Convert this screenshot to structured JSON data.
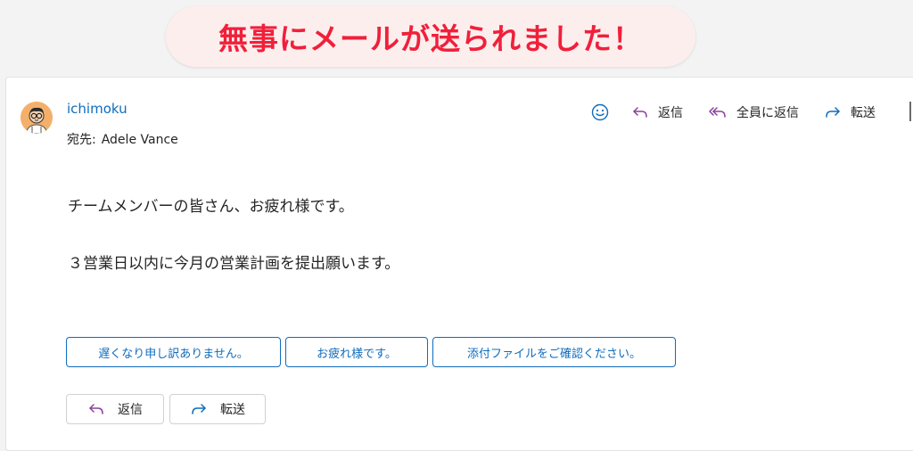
{
  "banner": {
    "text": "無事にメールが送られました！"
  },
  "message": {
    "sender": "ichimoku",
    "to_label": "宛先:",
    "to_name": "Adele Vance",
    "body_lines": [
      "チームメンバーの皆さん、お疲れ様です。",
      "３営業日以内に今月の営業計画を提出願います。"
    ]
  },
  "toolbar": {
    "reply_label": "返信",
    "reply_all_label": "全員に返信",
    "forward_label": "転送"
  },
  "suggested_replies": [
    "遅くなり申し訳ありません。",
    "お疲れ様です。",
    "添付ファイルをご確認ください。"
  ],
  "bottom": {
    "reply_label": "返信",
    "forward_label": "転送"
  },
  "colors": {
    "accent": "#0f6cbd",
    "reply_icon": "#8a3f9e",
    "banner_text": "#f0203a",
    "banner_bg": "#fdeeee"
  },
  "icons": {
    "emoji": "smiley-icon",
    "reply": "reply-arrow-icon",
    "reply_all": "reply-all-icon",
    "forward": "forward-arrow-icon"
  }
}
